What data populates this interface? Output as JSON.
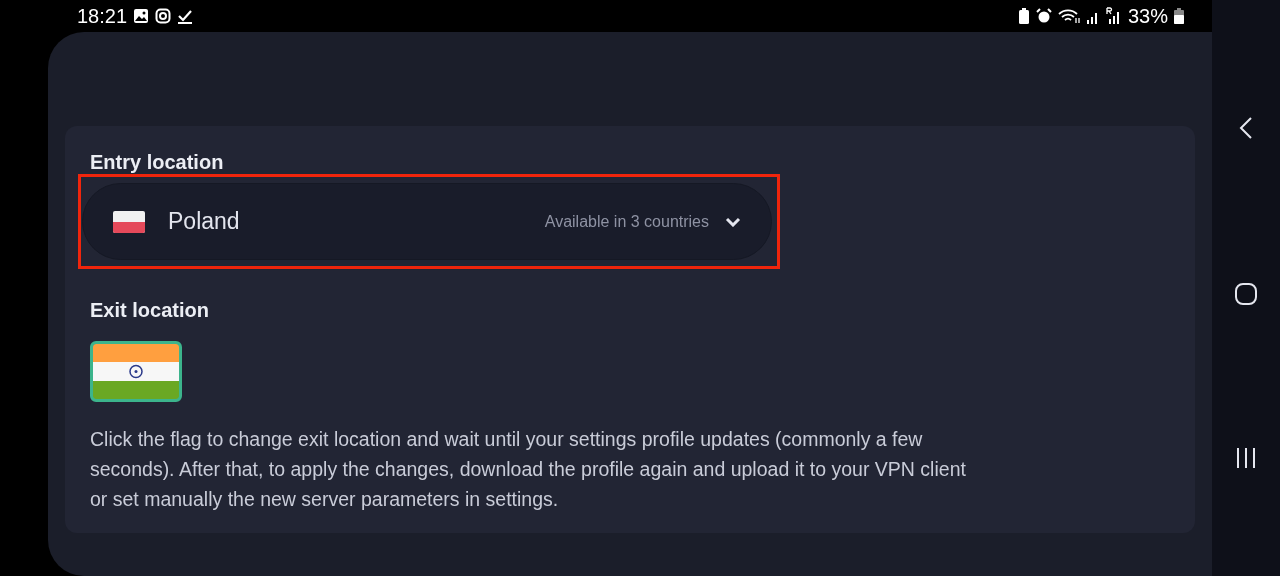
{
  "status_bar": {
    "time": "18:21",
    "battery": "33%"
  },
  "entry_location": {
    "label": "Entry location",
    "country": "Poland",
    "availability": "Available in 3 countries",
    "highlighted": true
  },
  "exit_location": {
    "label": "Exit location",
    "description": "Click the flag to change exit location and wait until your settings profile updates (commonly a few seconds). After that, to apply the changes, download the profile again and upload it to your VPN client or set manually the new server parameters in settings."
  }
}
